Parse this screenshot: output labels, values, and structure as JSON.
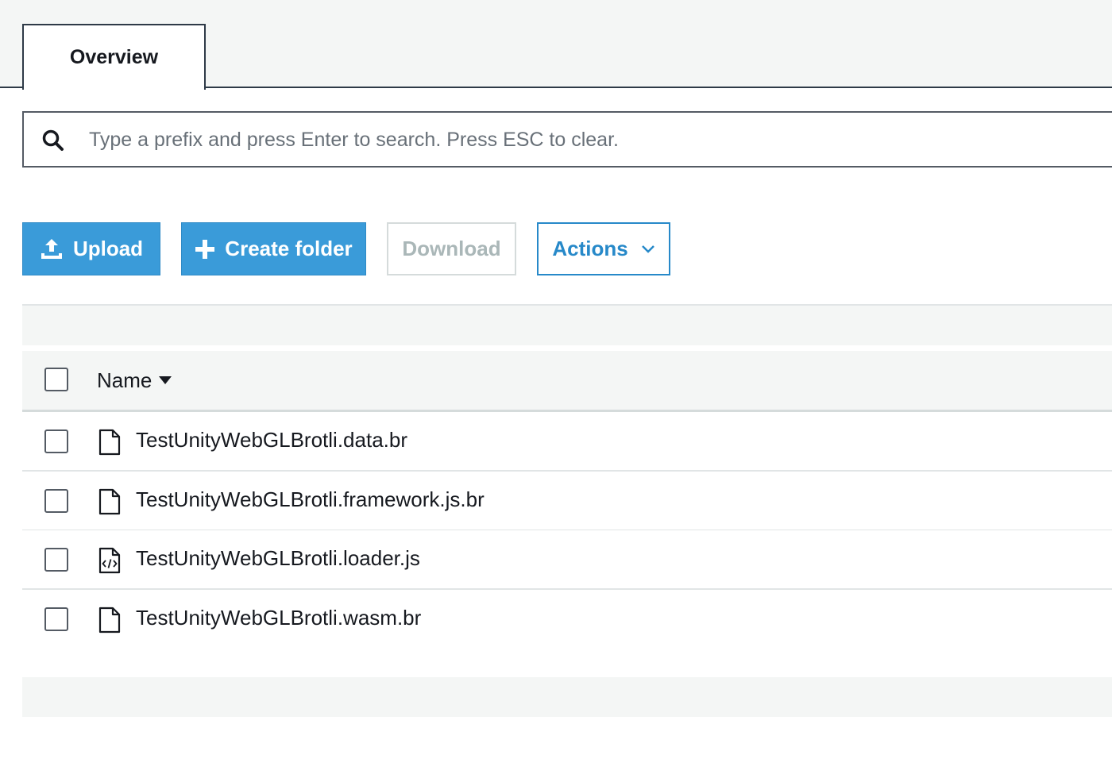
{
  "tabs": [
    {
      "label": "Overview",
      "active": true
    }
  ],
  "search": {
    "placeholder": "Type a prefix and press Enter to search. Press ESC to clear.",
    "value": "",
    "icon": "search-icon"
  },
  "toolbar": {
    "upload_label": "Upload",
    "create_folder_label": "Create folder",
    "download_label": "Download",
    "actions_label": "Actions"
  },
  "table": {
    "column_name": "Name",
    "rows": [
      {
        "name": "TestUnityWebGLBrotli.data.br",
        "icon": "file-icon"
      },
      {
        "name": "TestUnityWebGLBrotli.framework.js.br",
        "icon": "file-icon"
      },
      {
        "name": "TestUnityWebGLBrotli.loader.js",
        "icon": "code-file-icon"
      },
      {
        "name": "TestUnityWebGLBrotli.wasm.br",
        "icon": "file-icon"
      }
    ]
  },
  "colors": {
    "primary": "#3a9bd9",
    "actions": "#2789c9",
    "disabled": "#aab7b8",
    "text": "#16191f",
    "band": "#f4f6f5"
  }
}
